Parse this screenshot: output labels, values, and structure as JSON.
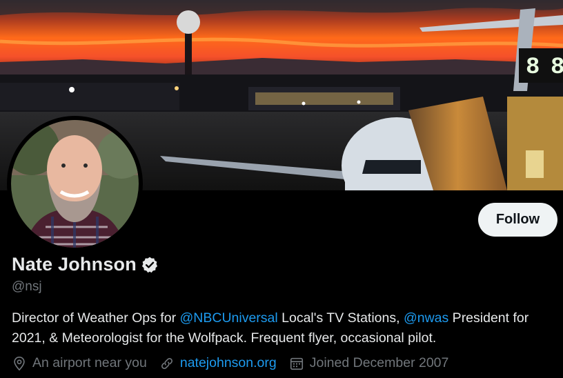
{
  "profile": {
    "name": "Nate Johnson",
    "handle": "@nsj",
    "follow_label": "Follow",
    "bio": {
      "part1": "Director of Weather Ops for ",
      "mention1": "@NBCUniversal",
      "part2": " Local's TV Stations, ",
      "mention2": "@nwas",
      "part3": " President for 2021, & Meteorologist for the Wolfpack. Frequent flyer, occasional pilot."
    },
    "location": "An airport near you",
    "website": "natejohnson.org",
    "joined": "Joined December 2007"
  },
  "banner": {
    "gate_number": "8"
  },
  "icons": {
    "verified": "verified-badge-icon",
    "location": "location-pin-icon",
    "link": "link-icon",
    "calendar": "calendar-icon"
  },
  "colors": {
    "background": "#000000",
    "accent": "#1d9bf0",
    "secondary_text": "#71767b",
    "primary_text": "#e7e9ea",
    "button_bg": "#eff3f4"
  }
}
